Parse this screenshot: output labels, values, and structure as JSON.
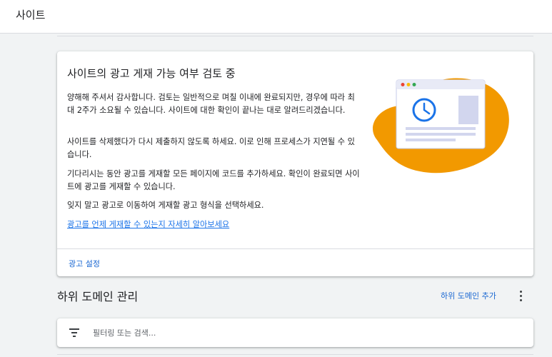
{
  "header": {
    "title": "사이트"
  },
  "review_card": {
    "title": "사이트의 광고 게재 가능 여부 검토 중",
    "paragraphs": [
      "양해해 주셔서 감사합니다. 검토는 일반적으로 며칠 이내에 완료되지만, 경우에 따라 최대 2주가 소요될 수 있습니다. 사이트에 대한 확인이 끝나는 대로 알려드리겠습니다.",
      "사이트를 삭제했다가 다시 제출하지 않도록 하세요. 이로 인해 프로세스가 지연될 수 있습니다.",
      "기다리시는 동안 광고를 게재할 모든 페이지에 코드를 추가하세요. 확인이 완료되면 사이트에 광고를 게재할 수 있습니다.",
      "잊지 말고 광고로 이동하여 게재할 광고 형식을 선택하세요."
    ],
    "learn_more_link": "광고를 언제 게재할 수 있는지 자세히 알아보세요",
    "footer_action": "광고 설정",
    "illustration": "review-clock-illustration"
  },
  "subdomains": {
    "title": "하위 도메인 관리",
    "add_label": "하위 도메인 추가",
    "more_icon": "more-vert-icon",
    "filter": {
      "icon": "filter-icon",
      "placeholder": "필터링 또는 검색...",
      "value": ""
    }
  },
  "colors": {
    "accent": "#1a73e8",
    "illustration_orange": "#f29900",
    "clock_blue": "#1a73e8"
  }
}
